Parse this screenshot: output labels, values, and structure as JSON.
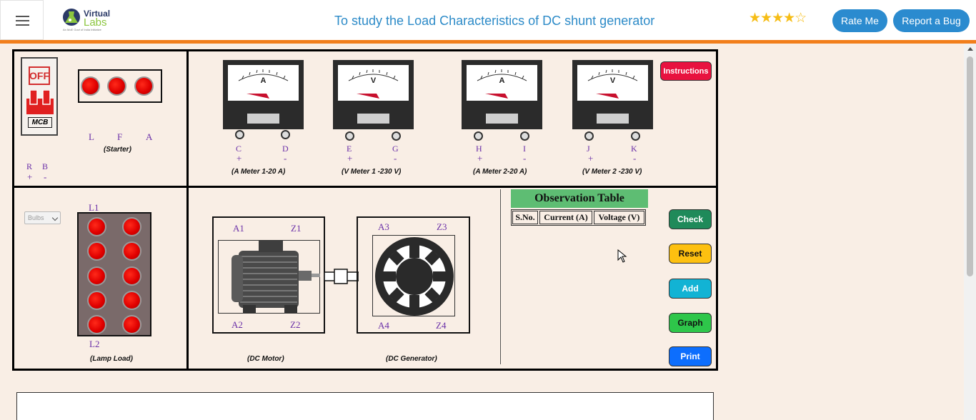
{
  "header": {
    "logo_line1": "Virtual",
    "logo_line2": "Labs",
    "logo_tagline": "An MoE Govt of India Initiative",
    "title": "To study the Load Characteristics of DC shunt generator",
    "rating": "4 of 5 stars",
    "stars": "★★★★☆",
    "rate_me": "Rate Me",
    "report_bug": "Report a Bug"
  },
  "mcb": {
    "off_label": "OFF",
    "label": "MCB"
  },
  "supply": {
    "r": "R",
    "b": "B",
    "r_sign": "+",
    "b_sign": "-"
  },
  "starter": {
    "l": "L",
    "f": "F",
    "a": "A",
    "label": "(Starter)"
  },
  "meters": [
    {
      "unit": "A",
      "t1": "C",
      "t2": "D",
      "s1": "+",
      "s2": "-",
      "label": "(A Meter 1-20 A)"
    },
    {
      "unit": "V",
      "t1": "E",
      "t2": "G",
      "s1": "+",
      "s2": "-",
      "label": "(V Meter 1 -230 V)"
    },
    {
      "unit": "A",
      "t1": "H",
      "t2": "I",
      "s1": "+",
      "s2": "-",
      "label": "(A Meter 2-20 A)"
    },
    {
      "unit": "V",
      "t1": "J",
      "t2": "K",
      "s1": "+",
      "s2": "-",
      "label": "(V Meter 2 -230 V)"
    }
  ],
  "instructions_button": "Instructions",
  "lamp_load": {
    "select_value": "Bulbs",
    "l1": "L1",
    "l2": "L2",
    "label": "(Lamp Load)"
  },
  "motor": {
    "a1": "A1",
    "z1": "Z1",
    "a2": "A2",
    "z2": "Z2",
    "label": "(DC Motor)"
  },
  "generator": {
    "a3": "A3",
    "z3": "Z3",
    "a4": "A4",
    "z4": "Z4",
    "label": "(DC Generator)"
  },
  "observation": {
    "title": "Observation Table",
    "columns": [
      "S.No.",
      "Current (A)",
      "Voltage (V)"
    ]
  },
  "buttons": {
    "check": "Check",
    "reset": "Reset",
    "add": "Add",
    "graph": "Graph",
    "print": "Print"
  },
  "colors": {
    "accent_orange": "#f27e1b",
    "primary_blue": "#2b8bcf",
    "instructions_red": "#e8123f",
    "check_green": "#1f8a5a",
    "reset_yellow": "#fdc010",
    "add_cyan": "#12b3d4",
    "graph_green": "#2ec64a",
    "print_blue": "#0d6efd",
    "lamp_red": "#e00000",
    "terminal_purple": "#6a2fa8"
  }
}
